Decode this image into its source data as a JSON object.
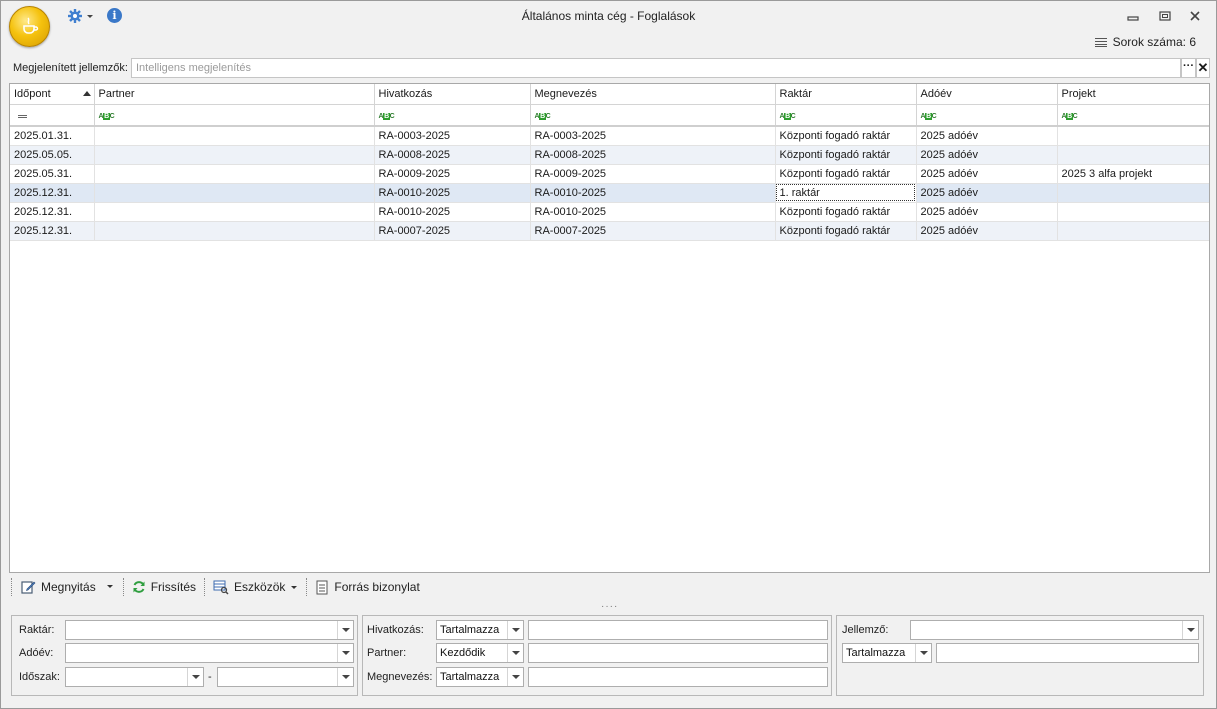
{
  "window": {
    "title": "Általános minta cég - Foglalások"
  },
  "status": {
    "row_count": "Sorok száma: 6"
  },
  "features": {
    "label": "Megjelenített jellemzők:",
    "placeholder": "Intelligens megjelenítés",
    "more": "···",
    "clear": "✕"
  },
  "grid": {
    "columns": [
      "Időpont",
      "Partner",
      "Hivatkozás",
      "Megnevezés",
      "Raktár",
      "Adóév",
      "Projekt"
    ],
    "rows": [
      [
        "2025.01.31.",
        "",
        "RA-0003-2025",
        "RA-0003-2025",
        "Központi fogadó raktár",
        "2025 adóév",
        ""
      ],
      [
        "2025.05.05.",
        "",
        "RA-0008-2025",
        "RA-0008-2025",
        "Központi fogadó raktár",
        "2025 adóév",
        ""
      ],
      [
        "2025.05.31.",
        "",
        "RA-0009-2025",
        "RA-0009-2025",
        "Központi fogadó raktár",
        "2025 adóév",
        "2025 3 alfa projekt"
      ],
      [
        "2025.12.31.",
        "",
        "RA-0010-2025",
        "RA-0010-2025",
        "1. raktár",
        "2025 adóév",
        ""
      ],
      [
        "2025.12.31.",
        "",
        "RA-0010-2025",
        "RA-0010-2025",
        "Központi fogadó raktár",
        "2025 adóév",
        ""
      ],
      [
        "2025.12.31.",
        "",
        "RA-0007-2025",
        "RA-0007-2025",
        "Központi fogadó raktár",
        "2025 adóév",
        ""
      ]
    ]
  },
  "toolbar": {
    "open": "Megnyitás",
    "refresh": "Frissítés",
    "tools": "Eszközök",
    "source": "Forrás bizonylat"
  },
  "filters": {
    "left": {
      "warehouse": "Raktár:",
      "tax_year": "Adóév:",
      "period": "Időszak:",
      "dash": "-"
    },
    "middle": {
      "reference": "Hivatkozás:",
      "reference_mode": "Tartalmazza",
      "partner": "Partner:",
      "partner_mode": "Kezdődik",
      "name": "Megnevezés:",
      "name_mode": "Tartalmazza"
    },
    "right": {
      "feature": "Jellemző:",
      "feature_mode": "Tartalmazza"
    }
  },
  "colors": {
    "selected_row": "#dfe8f4",
    "alt_row": "#eef2f8",
    "accent": "#3a78c8"
  }
}
